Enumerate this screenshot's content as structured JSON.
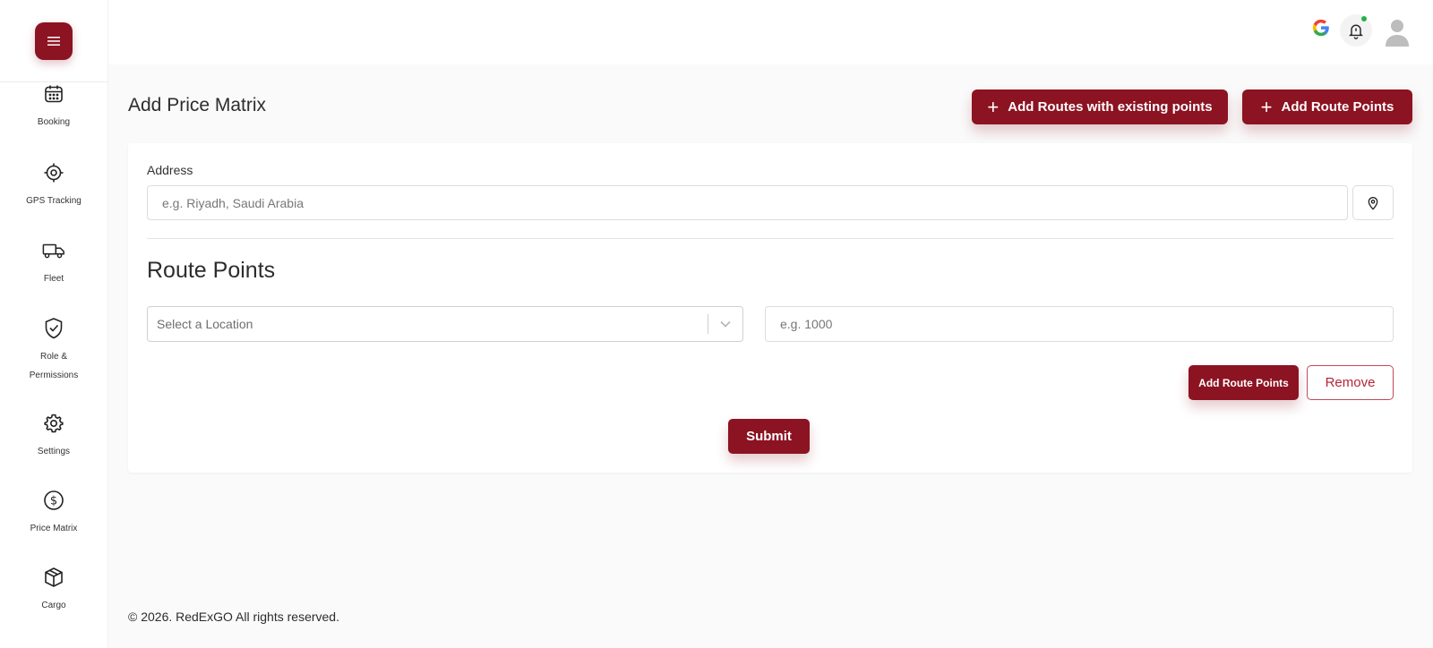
{
  "sidebar": {
    "menu_icon": "hamburger-icon",
    "items": [
      {
        "label": "Booking",
        "icon": "calendar-icon"
      },
      {
        "label": "GPS Tracking",
        "icon": "target-icon"
      },
      {
        "label": "Fleet",
        "icon": "truck-icon"
      },
      {
        "label": "Role &",
        "label2": "Permissions",
        "icon": "shield-check-icon"
      },
      {
        "label": "Settings",
        "icon": "gear-icon"
      },
      {
        "label": "Price Matrix",
        "icon": "dollar-circle-icon"
      },
      {
        "label": "Cargo",
        "icon": "box-icon"
      }
    ]
  },
  "header": {
    "icons": [
      "google-icon",
      "bell-icon",
      "avatar"
    ]
  },
  "page": {
    "title": "Add Price Matrix",
    "add_routes_existing_label": "Add Routes with existing points",
    "add_route_points_label": "Add Route Points"
  },
  "form": {
    "address_label": "Address",
    "address_placeholder": "e.g. Riyadh, Saudi Arabia",
    "route_points_title": "Route Points",
    "location_placeholder": "Select a Location",
    "price_placeholder": "e.g. 1000",
    "add_route_points_label": "Add Route Points",
    "remove_label": "Remove",
    "submit_label": "Submit"
  },
  "footer": {
    "text": "© 2026. RedExGO All rights reserved."
  },
  "colors": {
    "brand": "#8c1322",
    "notification_dot": "#22b14c"
  }
}
